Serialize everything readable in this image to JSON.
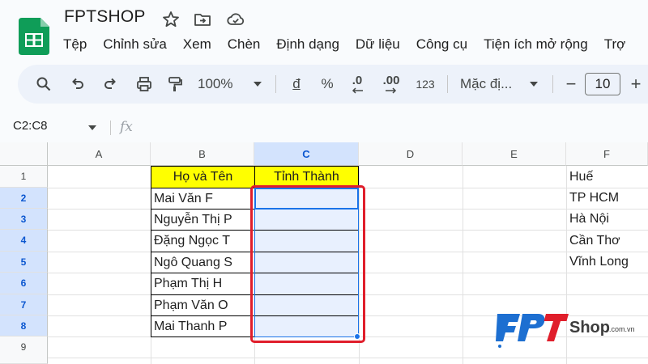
{
  "app": {
    "title": "FPTSHOP",
    "menu": [
      "Tệp",
      "Chỉnh sửa",
      "Xem",
      "Chèn",
      "Định dạng",
      "Dữ liệu",
      "Công cụ",
      "Tiện ích mở rộng",
      "Trợ"
    ]
  },
  "toolbar": {
    "zoom": "100%",
    "currency": "đ",
    "percent": "%",
    "decrease_decimal": ".0",
    "increase_decimal": ".00",
    "number_format": "123",
    "font": "Mặc đị...",
    "minus": "−",
    "font_size": "10",
    "plus": "+"
  },
  "formula_bar": {
    "name_box": "C2:C8",
    "fx": "fx"
  },
  "grid": {
    "columns": [
      "A",
      "B",
      "C",
      "D",
      "E",
      "F"
    ],
    "rows": [
      "1",
      "2",
      "3",
      "4",
      "5",
      "6",
      "7",
      "8",
      "9"
    ],
    "table_headers": {
      "b1": "Họ và Tên",
      "c1": "Tỉnh Thành"
    },
    "names": [
      "Mai Văn F",
      "Nguyễn Thị P",
      "Đặng Ngọc T",
      "Ngô Quang S",
      "Phạm Thị H",
      "Phạm Văn O",
      "Mai Thanh P"
    ],
    "provinces": [
      "Huế",
      "TP HCM",
      "Hà Nội",
      "Cần Thơ",
      "Vĩnh Long"
    ]
  },
  "watermark": {
    "brand": "FPT",
    "shop": "Shop",
    "domain": ".com.vn"
  },
  "colors": {
    "header_yellow": "#ffff00",
    "selection_blue": "#1a73e8",
    "highlight_red": "#e01e2b",
    "sheets_green": "#0f9d58"
  }
}
